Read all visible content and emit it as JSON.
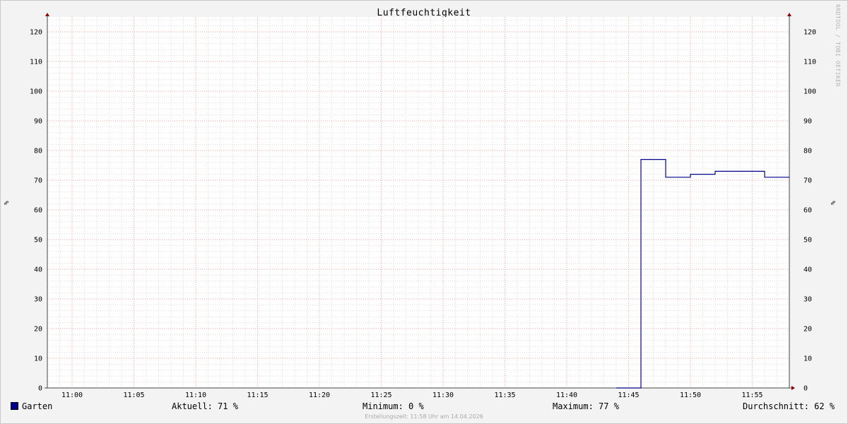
{
  "watermark": "RRDTOOL / TOBI OETIKER",
  "footer": "Erstellungszeit: 11:58 Uhr am 14.04.2026",
  "legend": {
    "series_name": "Garten",
    "aktuell": "Aktuell:  71 %",
    "minimum": "Minimum:   0 %",
    "maximum": "Maximum:  77 %",
    "durchschnitt": "Durchschnitt:  62 %"
  },
  "colors": {
    "series": "#00008b",
    "grid_major": "#f0a0a0",
    "grid_minor": "#dddddd",
    "axis": "#444444",
    "arrow": "#8b0000"
  },
  "chart_data": {
    "type": "line",
    "title": "Luftfeuchtigkeit",
    "xlabel": "",
    "ylabel": "%",
    "y2label": "%",
    "ylim": [
      0,
      125
    ],
    "yticks": [
      0,
      10,
      20,
      30,
      40,
      50,
      60,
      70,
      80,
      90,
      100,
      110,
      120
    ],
    "xlim": [
      "10:58",
      "11:58"
    ],
    "xticks": [
      "11:00",
      "11:05",
      "11:10",
      "11:15",
      "11:20",
      "11:25",
      "11:30",
      "11:35",
      "11:40",
      "11:45",
      "11:50",
      "11:55"
    ],
    "grid": true,
    "legend_position": "bottom-left",
    "step": true,
    "series": [
      {
        "name": "Garten",
        "x": [
          "11:44",
          "11:46",
          "11:48",
          "11:50",
          "11:52",
          "11:56"
        ],
        "values": [
          0,
          77,
          71,
          72,
          73,
          71
        ]
      }
    ]
  }
}
